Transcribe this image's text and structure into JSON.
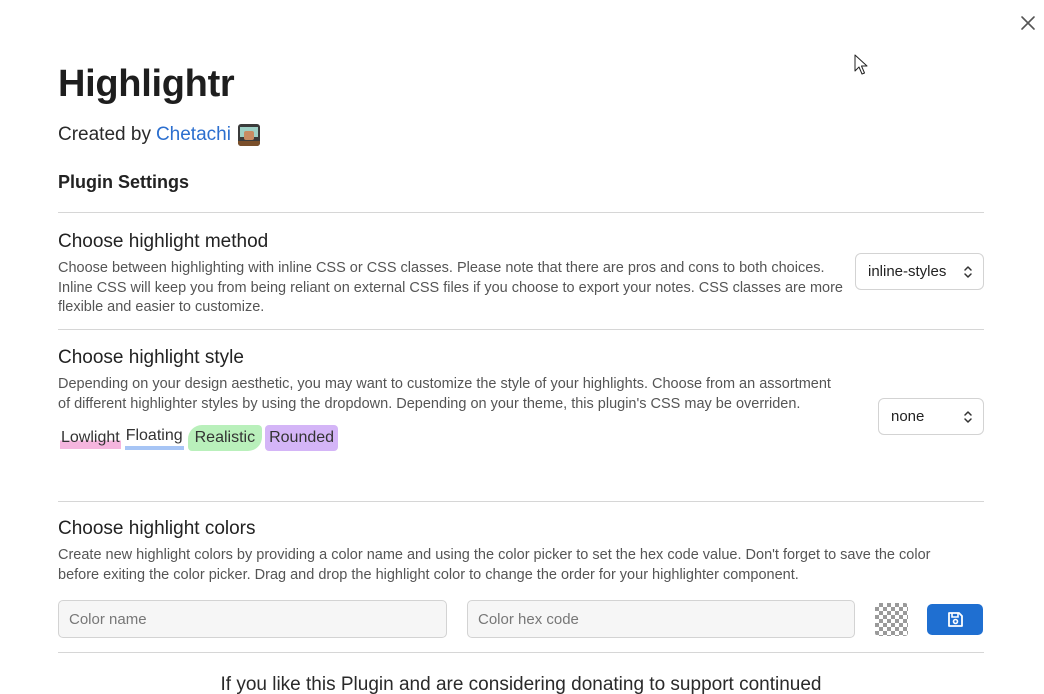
{
  "modal": {
    "title": "Highlightr",
    "created_by_prefix": "Created by",
    "author_name": "Chetachi",
    "section_title": "Plugin Settings"
  },
  "settings": {
    "method": {
      "name": "Choose highlight method",
      "description": "Choose between highlighting with inline CSS or CSS classes. Please note that there are pros and cons to both choices. Inline CSS will keep you from being reliant on external CSS files if you choose to export your notes. CSS classes are more flexible and easier to customize.",
      "selected": "inline-styles"
    },
    "style": {
      "name": "Choose highlight style",
      "description": "Depending on your design aesthetic, you may want to customize the style of your highlights. Choose from an assortment of different highlighter styles by using the dropdown. Depending on your theme, this plugin's CSS may be overriden.",
      "selected": "none",
      "samples": [
        "Lowlight",
        "Floating",
        "Realistic",
        "Rounded"
      ]
    },
    "colors": {
      "name": "Choose highlight colors",
      "description": "Create new highlight colors by providing a color name and using the color picker to set the hex code value. Don't forget to save the color before exiting the color picker. Drag and drop the highlight color to change the order for your highlighter component.",
      "name_placeholder": "Color name",
      "hex_placeholder": "Color hex code"
    }
  },
  "donate_text": "If you like this Plugin and are considering donating to support continued",
  "icons": {
    "close": "close-icon",
    "chevron": "chevron-updown-icon",
    "save": "floppy-disk-icon",
    "avatar": "developer-emoji-icon",
    "cursor": "mouse-pointer-icon"
  },
  "colors": {
    "link": "#2c6fcf",
    "save_button": "#1f6fd1",
    "lowlight": "#f5b5de",
    "floating": "#a7c5f5",
    "realistic": "#b9f0bb",
    "rounded": "#d4b5f7"
  }
}
